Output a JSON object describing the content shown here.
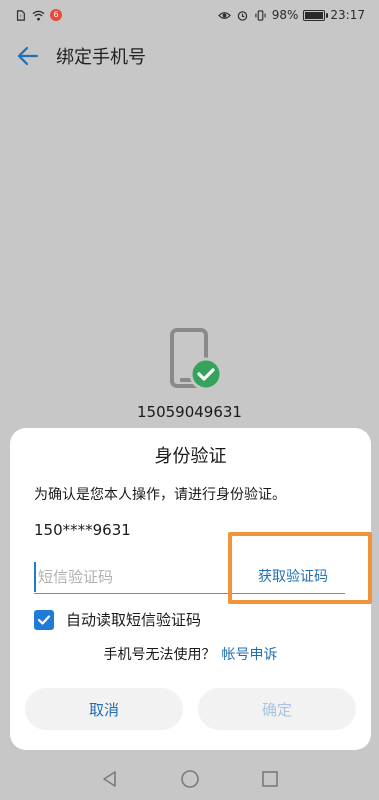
{
  "status_bar": {
    "notification_badge": "6",
    "battery_percent": "98%",
    "battery_level": 0.98,
    "time": "23:17"
  },
  "app_bar": {
    "title": "绑定手机号"
  },
  "background": {
    "phone_number": "15059049631"
  },
  "dialog": {
    "title": "身份验证",
    "description": "为确认是您本人操作，请进行身份验证。",
    "masked_phone": "150****9631",
    "code_placeholder": "短信验证码",
    "code_value": "",
    "get_code_label": "获取验证码",
    "auto_read_label": "自动读取短信验证码",
    "auto_read_checked": true,
    "help_question": "手机号无法使用？",
    "help_link": "帐号申诉",
    "cancel_label": "取消",
    "confirm_label": "确定"
  },
  "colors": {
    "accent": "#1f7bd8",
    "link": "#1f6fb5",
    "highlight": "#f2923b",
    "success": "#35a35a",
    "overlay": "#c7c7c7"
  },
  "icons": [
    "sim-icon",
    "wifi-icon",
    "eye-icon",
    "alarm-icon",
    "vibrate-icon",
    "battery-icon",
    "back-arrow-icon",
    "phone-icon",
    "check-circle-icon",
    "checkbox-check-icon",
    "nav-back-icon",
    "nav-home-icon",
    "nav-recents-icon"
  ]
}
